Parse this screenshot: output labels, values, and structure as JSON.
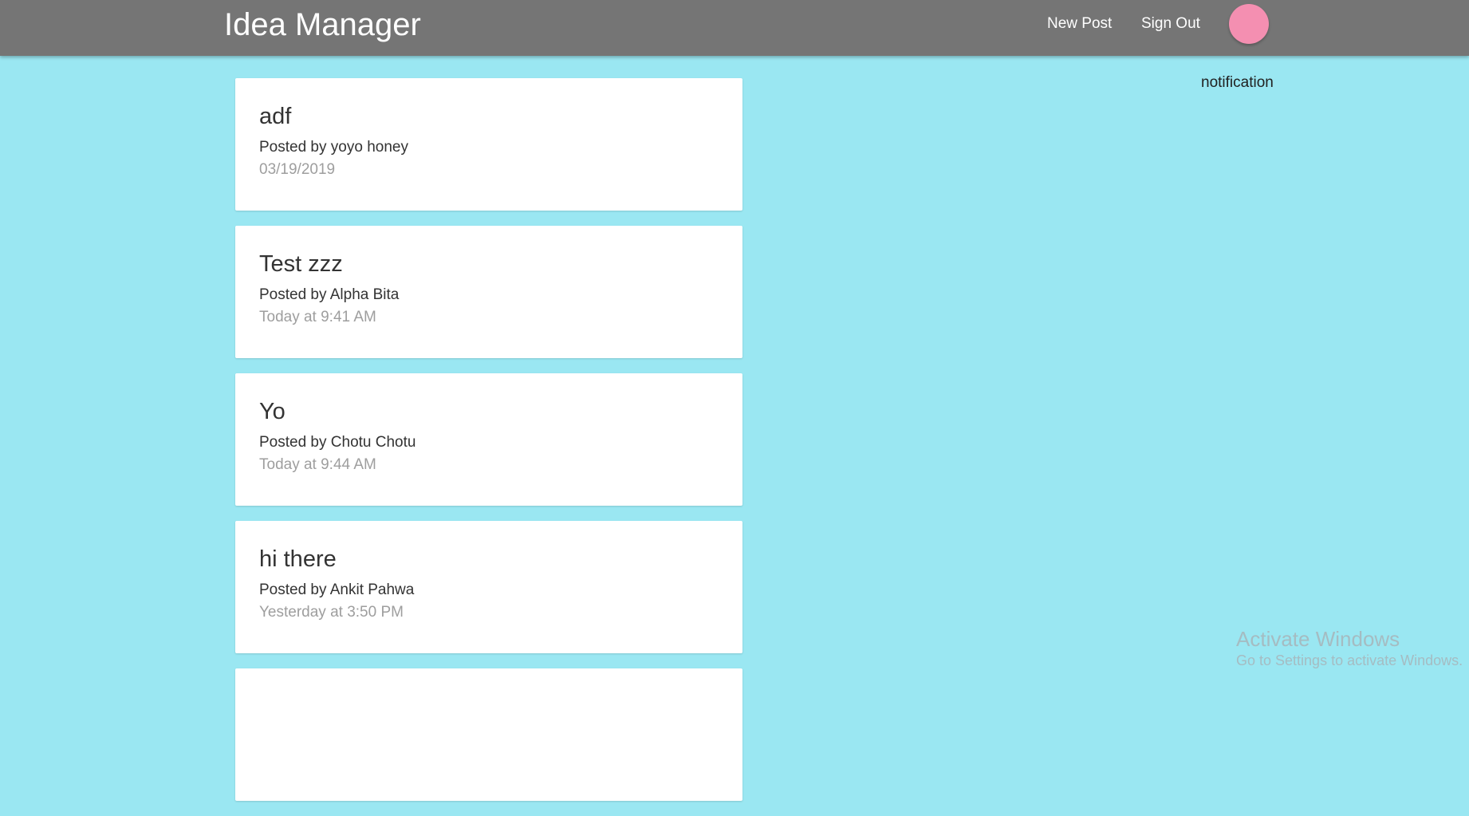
{
  "navbar": {
    "brand": "Idea Manager",
    "links": [
      {
        "label": "New Post"
      },
      {
        "label": "Sign Out"
      }
    ],
    "avatar_color": "#f48fb1",
    "background": "#757575"
  },
  "page_background": "#9ae7f2",
  "notification": {
    "label": "notification"
  },
  "posts": [
    {
      "title": "adf",
      "author": "Posted by yoyo honey",
      "date": "03/19/2019"
    },
    {
      "title": "Test zzz",
      "author": "Posted by Alpha Bita",
      "date": "Today at 9:41 AM"
    },
    {
      "title": "Yo",
      "author": "Posted by Chotu Chotu",
      "date": "Today at 9:44 AM"
    },
    {
      "title": "hi there",
      "author": "Posted by Ankit Pahwa",
      "date": "Yesterday at 3:50 PM"
    },
    {
      "title": "",
      "author": "",
      "date": ""
    }
  ],
  "watermark": {
    "title": "Activate Windows",
    "subtitle": "Go to Settings to activate Windows."
  }
}
